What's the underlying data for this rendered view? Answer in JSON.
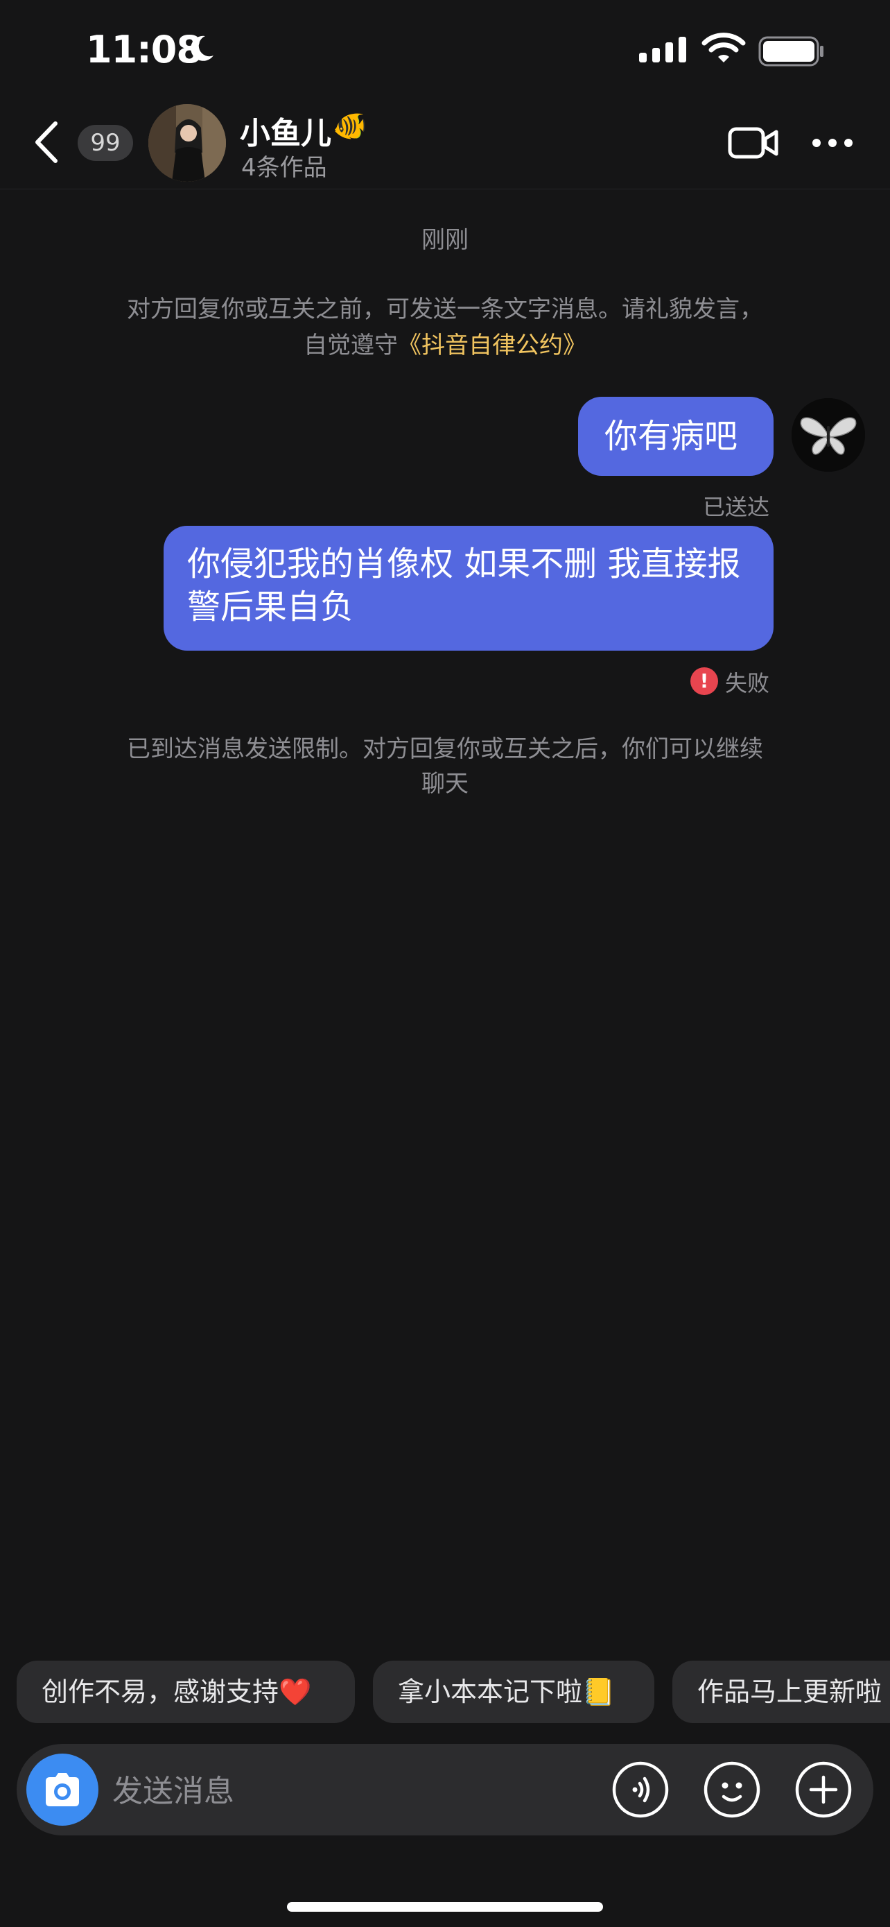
{
  "status_bar": {
    "time": "11:08"
  },
  "header": {
    "unread_count": "99",
    "contact_name": "小鱼儿",
    "contact_emoji": "🐠",
    "works_count": "4条作品"
  },
  "chat": {
    "timestamp": "刚刚",
    "notice_line1": "对方回复你或互关之前，可发送一条文字消息。请礼貌发言，",
    "notice_line2_prefix": "自觉遵守",
    "notice_link": "《抖音自律公约》",
    "messages": [
      {
        "text": "你有病吧",
        "status": "已送达"
      },
      {
        "text": "你侵犯我的肖像权 如果不删 我直接报警后果自负",
        "status": "失败"
      }
    ],
    "limit_notice_line1": "已到达消息发送限制。对方回复你或互关之后，你们可以继续",
    "limit_notice_line2": "聊天"
  },
  "quick_replies": [
    "创作不易，感谢支持❤️",
    "拿小本本记下啦📒",
    "作品马上更新啦"
  ],
  "input": {
    "placeholder": "发送消息"
  },
  "colors": {
    "background": "#151516",
    "bubble": "#5468e0",
    "link": "#f2c560",
    "error": "#e8454f",
    "camera_button": "#3c8cf2"
  }
}
